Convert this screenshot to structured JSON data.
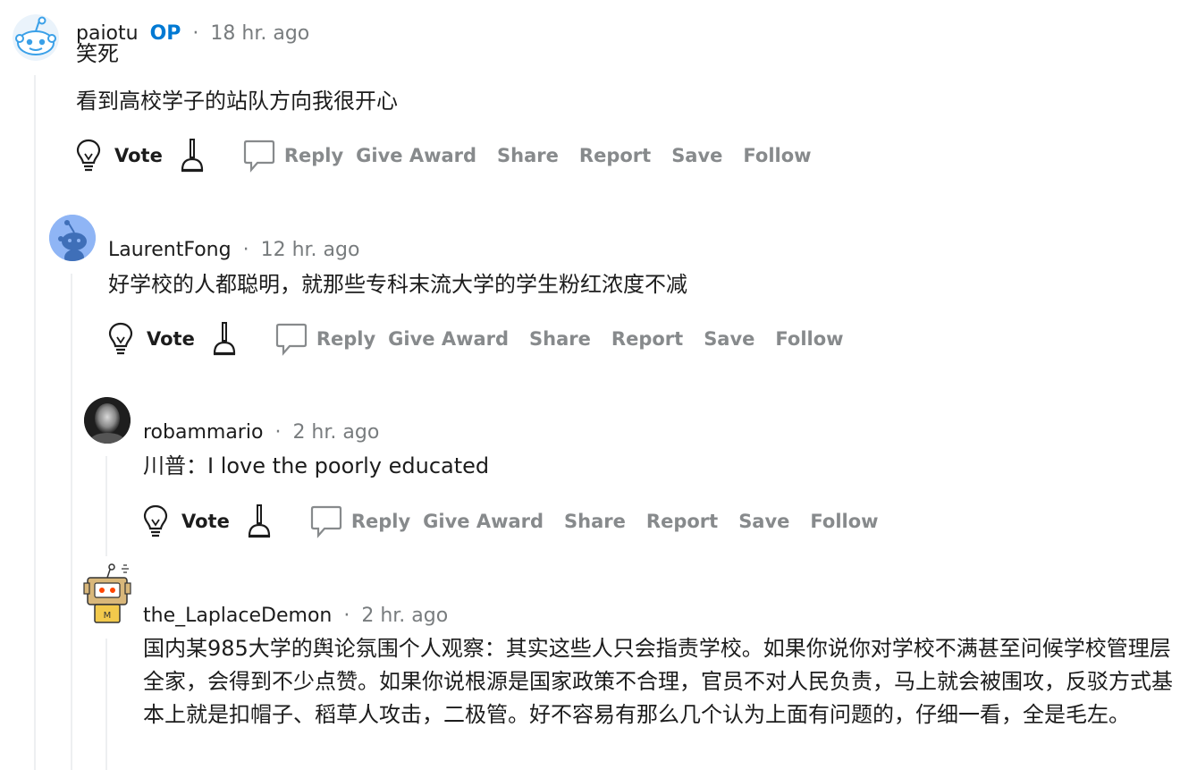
{
  "comments": [
    {
      "author": "paiotu",
      "op_badge": "OP",
      "separator": "·",
      "time": "18 hr. ago",
      "body_lines": [
        "笑死",
        "看到高校学子的站队方向我很开心"
      ],
      "avatar_icon": "reddit-snoo-default-avatar"
    },
    {
      "author": "LaurentFong",
      "separator": "·",
      "time": "12 hr. ago",
      "body": "好学校的人都聪明，就那些专科末流大学的学生粉红浓度不减",
      "avatar_icon": "reddit-snoo-blue-avatar"
    },
    {
      "author": "robammario",
      "separator": "·",
      "time": "2 hr. ago",
      "body": "川普：I love the poorly educated",
      "avatar_icon": "photo-avatar"
    },
    {
      "author": "the_LaplaceDemon",
      "separator": "·",
      "time": "2 hr. ago",
      "body": "国内某985大学的舆论氛围个人观察：其实这些人只会指责学校。如果你说你对学校不满甚至问候学校管理层全家，会得到不少点赞。如果你说根源是国家政策不合理，官员不对人民负责，马上就会被围攻，反驳方式基本上就是扣帽子、稻草人攻击，二极管。好不容易有那么几个认为上面有问题的，仔细一看，全是毛左。",
      "avatar_icon": "box-robot-avatar"
    }
  ],
  "actions": {
    "vote": "Vote",
    "reply": "Reply",
    "give_award": "Give Award",
    "share": "Share",
    "report": "Report",
    "save": "Save",
    "follow": "Follow",
    "upvote_icon": "lightbulb-upvote-icon",
    "downvote_icon": "plunger-downvote-icon",
    "reply_icon": "speech-bubble-icon"
  },
  "colors": {
    "op": "#0079d3",
    "muted": "#787c7e",
    "action": "#878a8c",
    "thread_line": "#edeff1"
  }
}
